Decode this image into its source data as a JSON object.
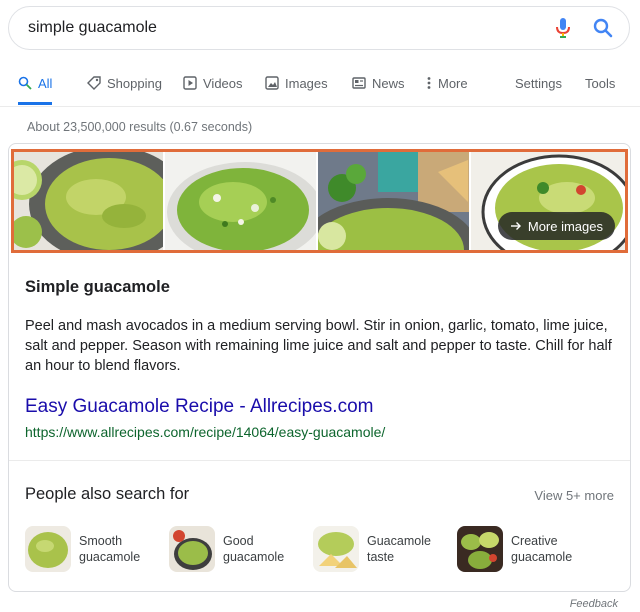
{
  "search": {
    "query": "simple guacamole"
  },
  "tabs": [
    {
      "label": "All",
      "icon": "search-icon"
    },
    {
      "label": "Shopping",
      "icon": "tag-icon"
    },
    {
      "label": "Videos",
      "icon": "play-icon"
    },
    {
      "label": "Images",
      "icon": "image-icon"
    },
    {
      "label": "News",
      "icon": "newspaper-icon"
    },
    {
      "label": "More",
      "icon": "kebab-icon"
    }
  ],
  "tools": {
    "settings": "Settings",
    "tools": "Tools"
  },
  "results_count": "About 23,500,000 results (0.67 seconds)",
  "images": {
    "more_label": "More images"
  },
  "knowledge": {
    "title": "Simple guacamole",
    "description": "Peel and mash avocados in a medium serving bowl. Stir in onion, garlic, tomato, lime juice, salt and pepper. Season with remaining lime juice and salt and pepper to taste. Chill for half an hour to blend flavors.",
    "link_title": "Easy Guacamole Recipe - Allrecipes.com",
    "link_url": "https://www.allrecipes.com/recipe/14064/easy-guacamole/"
  },
  "pasf": {
    "title": "People also search for",
    "view_more": "View 5+ more",
    "items": [
      {
        "line1": "Smooth",
        "line2": "guacamole"
      },
      {
        "line1": "Good",
        "line2": "guacamole"
      },
      {
        "line1": "Guacamole",
        "line2": "taste"
      },
      {
        "line1": "Creative",
        "line2": "guacamole"
      }
    ]
  },
  "footer": {
    "feedback": "Feedback"
  },
  "colors": {
    "accent": "#1a73e8",
    "link": "#1a0dab",
    "url": "#0d652d",
    "highlight_border": "#e06c3a"
  }
}
